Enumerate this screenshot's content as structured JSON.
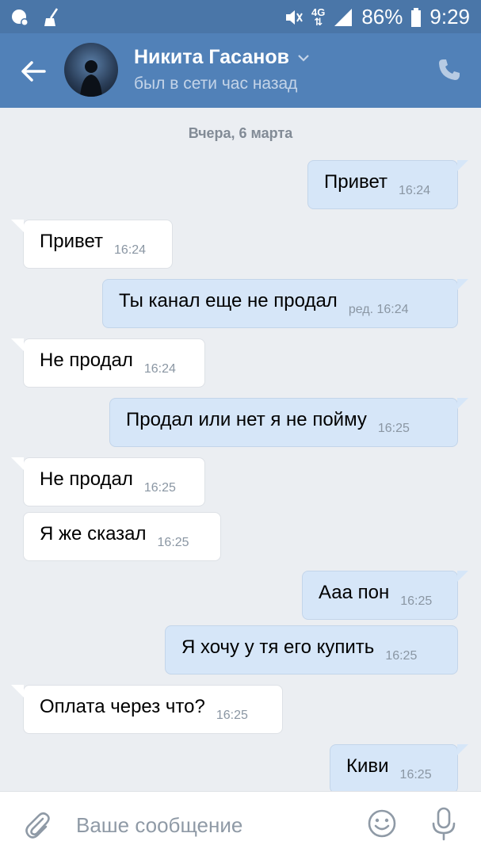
{
  "status_bar": {
    "battery": "86%",
    "time": "9:29",
    "network": "4G",
    "icons": [
      "viber-icon",
      "broom-icon",
      "mute-icon",
      "signal-icon",
      "battery-icon"
    ]
  },
  "header": {
    "back_icon": "arrow-left-icon",
    "name": "Никита Гасанов",
    "status": "был в сети час назад",
    "call_icon": "phone-icon"
  },
  "chat": {
    "date_separator": "Вчера, 6 марта",
    "messages": [
      {
        "dir": "out",
        "text": "Привет",
        "time": "16:24"
      },
      {
        "dir": "in",
        "text": "Привет",
        "time": "16:24"
      },
      {
        "dir": "out",
        "text": "Ты канал еще не продал",
        "time": "ред. 16:24"
      },
      {
        "dir": "in",
        "text": "Не продал",
        "time": "16:24"
      },
      {
        "dir": "out",
        "text": "Продал или нет я не пойму",
        "time": "16:25"
      },
      {
        "dir": "in",
        "text": "Не продал",
        "time": "16:25"
      },
      {
        "dir": "in",
        "text": "Я же сказал",
        "time": "16:25"
      },
      {
        "dir": "out",
        "text": "Ааа пон",
        "time": "16:25"
      },
      {
        "dir": "out",
        "text": "Я хочу у тя его купить",
        "time": "16:25"
      },
      {
        "dir": "in",
        "text": "Оплата через что?",
        "time": "16:25"
      },
      {
        "dir": "out",
        "text": "Киви",
        "time": "16:25"
      }
    ]
  },
  "composer": {
    "placeholder": "Ваше сообщение",
    "attach_icon": "paperclip-icon",
    "emoji_icon": "smile-icon",
    "voice_icon": "microphone-icon"
  },
  "colors": {
    "header": "#5181b8",
    "status_bar": "#4a76a8",
    "outgoing_bubble": "#d6e6f8",
    "incoming_bubble": "#ffffff",
    "chat_background": "#ebeef2"
  }
}
